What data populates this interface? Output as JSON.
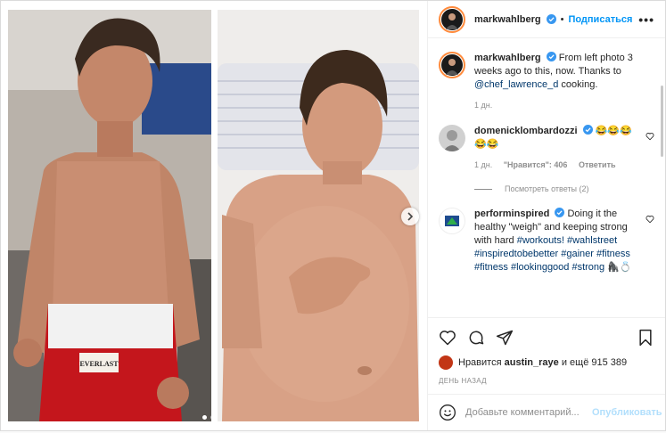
{
  "header": {
    "username": "markwahlberg",
    "separator": "•",
    "follow_label": "Подписаться",
    "more_label": "•••"
  },
  "caption": {
    "username": "markwahlberg",
    "text": "From left photo 3 weeks ago to this, now. Thanks to",
    "mention": "@chef_lawrence_d",
    "text_after": "cooking.",
    "time": "1 дн."
  },
  "comments": [
    {
      "username": "domenicklombardozzi",
      "text": "😂😂😂 😂😂",
      "time": "1 дн.",
      "likes": "\"Нравится\": 406",
      "reply_label": "Ответить",
      "view_replies": "Посмотреть ответы (2)"
    },
    {
      "username": "performinspired",
      "text": "Doing it the healthy \"weigh\" and keeping strong with hard",
      "hashtags": "#workouts! #wahlstreet #inspiredtobebetter #gainer #fitness #fitness #lookinggood #strong 🦍💍"
    }
  ],
  "likes": {
    "text_prefix": "Нравится",
    "user": "austin_raye",
    "text_suffix": "и ещё 915 389"
  },
  "timestamp": "ДЕНЬ НАЗАД",
  "add_comment": {
    "placeholder": "Добавьте комментарий...",
    "publish_label": "Опубликовать"
  },
  "colors": {
    "accent": "#0095f6",
    "link": "#00376b",
    "muted": "#8e8e8e",
    "verified": "#3897f0"
  },
  "icons": [
    "verified-icon",
    "heart-icon",
    "comment-icon",
    "share-icon",
    "bookmark-icon",
    "emoji-icon",
    "chevron-right-icon"
  ]
}
